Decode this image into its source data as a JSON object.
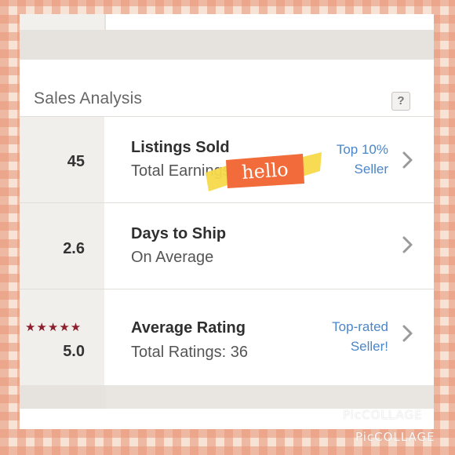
{
  "section": {
    "title": "Sales Analysis",
    "help_label": "?"
  },
  "rows": [
    {
      "value": "45",
      "label": "Listings Sold",
      "sublabel": "Total Earnings",
      "badge_line1": "Top 10%",
      "badge_line2": "Seller"
    },
    {
      "value": "2.6",
      "label": "Days to Ship",
      "sublabel": "On Average",
      "badge_line1": "",
      "badge_line2": ""
    },
    {
      "value": "5.0",
      "label": "Average Rating",
      "sublabel": "Total Ratings: 36",
      "badge_line1": "Top-rated",
      "badge_line2": "Seller!",
      "stars": "★★★★★",
      "star_count": 5
    }
  ],
  "sticker": {
    "text": "hello",
    "color": "#f26b3a",
    "ribbon_color": "#f7d94a"
  },
  "watermark": {
    "text1": "PicCOLLAGE",
    "text2": "PicCOLLAGE"
  },
  "colors": {
    "link_blue": "#4a86c8",
    "star_red": "#8c1f2d",
    "background_check": "#e8967a"
  }
}
